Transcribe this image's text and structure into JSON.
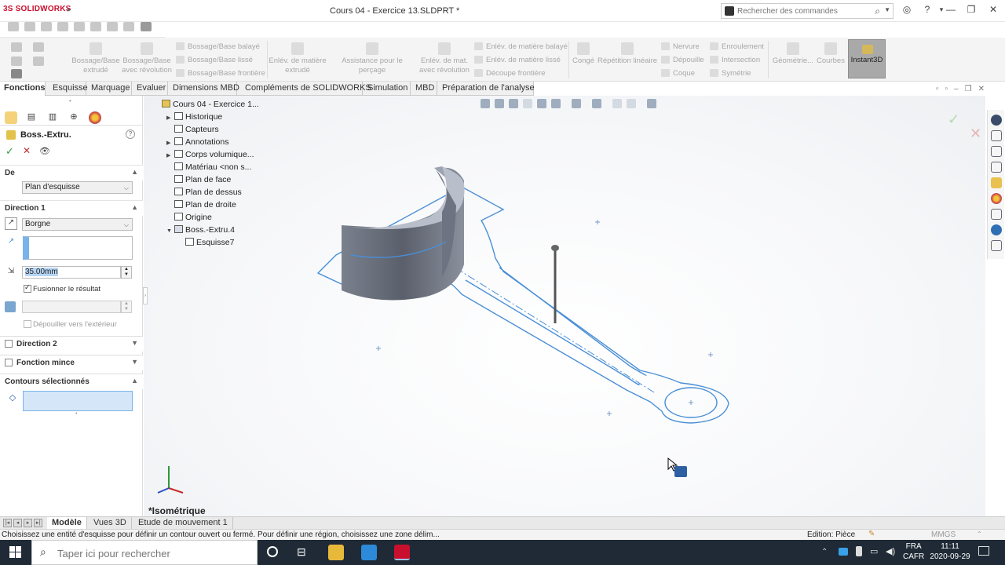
{
  "app": {
    "brand_ds": "3S",
    "brand_name": "SOLIDWORKS",
    "doc_title": "Cours 04 - Exercice 13.SLDPRT *"
  },
  "search": {
    "placeholder": "Rechercher des commandes"
  },
  "ribbon": {
    "bossage_extrude": "Bossage/Base extrudé",
    "bossage_revolution": "Bossage/Base avec révolution",
    "bossage_balaye": "Bossage/Base balayé",
    "bossage_lisse": "Bossage/Base lissé",
    "bossage_frontiere": "Bossage/Base frontière",
    "enlev_extrude": "Enlév. de matière extrudé",
    "assistance_percage": "Assistance pour le perçage",
    "enlev_revolution": "Enlév. de mat. avec révolution",
    "enlev_balaye": "Enlév. de matière balayé",
    "enlev_lisse": "Enlév. de matière lissé",
    "decoupe_frontiere": "Découpe frontière",
    "conge": "Congé",
    "repetition": "Répétition linéaire",
    "nervure": "Nervure",
    "depouille": "Dépouille",
    "coque": "Coque",
    "enroulement": "Enroulement",
    "intersection": "Intersection",
    "symetrie": "Symétrie",
    "geometrie": "Géométrie...",
    "courbes": "Courbes",
    "instant3d": "Instant3D"
  },
  "tabs": [
    "Fonctions",
    "Esquisse",
    "Marquage",
    "Evaluer",
    "Dimensions MBD",
    "Compléments de SOLIDWORKS",
    "Simulation",
    "MBD",
    "Préparation de l'analyse"
  ],
  "property": {
    "title": "Boss.-Extru.",
    "de_label": "De",
    "de_value": "Plan d'esquisse",
    "direction1_label": "Direction 1",
    "end_condition": "Borgne",
    "depth": "35.00mm",
    "merge_label": "Fusionner le résultat",
    "merge_checked": true,
    "draft_label": "Dépouiller vers l'extérieur",
    "direction2_label": "Direction 2",
    "thin_label": "Fonction mince",
    "contours_label": "Contours sélectionnés"
  },
  "tree": [
    {
      "label": "Cours 04 - Exercice 1...",
      "indent": 0,
      "expander": "",
      "icon": "part-icon"
    },
    {
      "label": "Historique",
      "indent": 1,
      "expander": "▶",
      "icon": "history-icon"
    },
    {
      "label": "Capteurs",
      "indent": 1,
      "expander": "",
      "icon": "sensor-icon"
    },
    {
      "label": "Annotations",
      "indent": 1,
      "expander": "▶",
      "icon": "annotation-icon"
    },
    {
      "label": "Corps volumique...",
      "indent": 1,
      "expander": "▶",
      "icon": "solid-body-icon"
    },
    {
      "label": "Matériau <non s...",
      "indent": 1,
      "expander": "",
      "icon": "material-icon"
    },
    {
      "label": "Plan de face",
      "indent": 1,
      "expander": "",
      "icon": "plane-icon"
    },
    {
      "label": "Plan de dessus",
      "indent": 1,
      "expander": "",
      "icon": "plane-icon"
    },
    {
      "label": "Plan de droite",
      "indent": 1,
      "expander": "",
      "icon": "plane-icon"
    },
    {
      "label": "Origine",
      "indent": 1,
      "expander": "",
      "icon": "origin-icon"
    },
    {
      "label": "Boss.-Extru.4",
      "indent": 1,
      "expander": "▼",
      "icon": "extrude-icon"
    },
    {
      "label": "Esquisse7",
      "indent": 2,
      "expander": "",
      "icon": "sketch-icon"
    }
  ],
  "viewport": {
    "view_name": "*Isométrique"
  },
  "bottom_tabs": [
    "Modèle",
    "Vues 3D",
    "Etude de mouvement 1"
  ],
  "status": {
    "message": "Choisissez une entité d'esquisse pour définir un contour ouvert ou fermé. Pour définir une région, choisissez une zone délim...",
    "edition": "Edition: Pièce",
    "units": "MMGS"
  },
  "taskbar": {
    "search_placeholder": "Taper ici pour rechercher",
    "lang1": "FRA",
    "lang2": "CAFR",
    "time": "11:11",
    "date": "2020-09-29"
  },
  "colors": {
    "sketch": "#4a8fd6",
    "part_top": "#b6bcc7",
    "part_side": "#6c7280",
    "brand": "#c8102e"
  }
}
